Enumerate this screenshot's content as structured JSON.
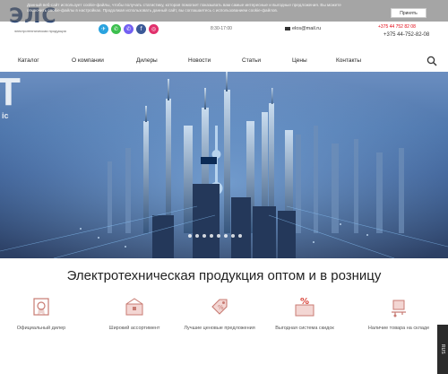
{
  "header": {
    "logo_text": "ЭЛС",
    "logo_tagline": "электротехническая продукция",
    "socials": [
      {
        "name": "telegram",
        "color": "#2aa3df",
        "glyph": "✈"
      },
      {
        "name": "whatsapp",
        "color": "#3cbf4e",
        "glyph": "✆"
      },
      {
        "name": "viber",
        "color": "#7360f2",
        "glyph": "✆"
      },
      {
        "name": "facebook",
        "color": "#3b5998",
        "glyph": "f"
      },
      {
        "name": "instagram",
        "color": "#e1306c",
        "glyph": "◎"
      }
    ],
    "hours": "8:30-17:00",
    "email": "elos@mail.ru",
    "phone_top": "+375 44 752 82 08",
    "phone": "+375 44-752-82-08"
  },
  "cookie": {
    "text": "Данный веб-сайт использует cookie-файлы, чтобы получать статистику, которая помогает показывать вам самые интересные и выгодные предложения. Вы можете отключить cookie-файлы в настройках. Продолжая использовать данный сайт, вы соглашаетесь с использованием cookie-файлов.",
    "button": "Принять"
  },
  "nav": {
    "items": [
      "Каталог",
      "О компании",
      "Дилеры",
      "Новости",
      "Статьи",
      "Цены",
      "Контакты"
    ]
  },
  "hero": {
    "partial_text": "T",
    "partial_sub": "ic",
    "dots": 8
  },
  "headline": "Электротехническая продукция оптом и в розницу",
  "features": [
    {
      "label": "Официальный дилер",
      "icon": "certificate-icon"
    },
    {
      "label": "Широкий ассортимент",
      "icon": "box-icon"
    },
    {
      "label": "Лучшие ценовые предложения",
      "icon": "price-tag-icon"
    },
    {
      "label": "Выгодная система скидок",
      "icon": "discount-icon"
    },
    {
      "label": "Наличие товара на складе",
      "icon": "warehouse-icon"
    }
  ],
  "lang_tab": "RUS",
  "colors": {
    "accent": "#e30613",
    "brand": "#1d3d73"
  }
}
